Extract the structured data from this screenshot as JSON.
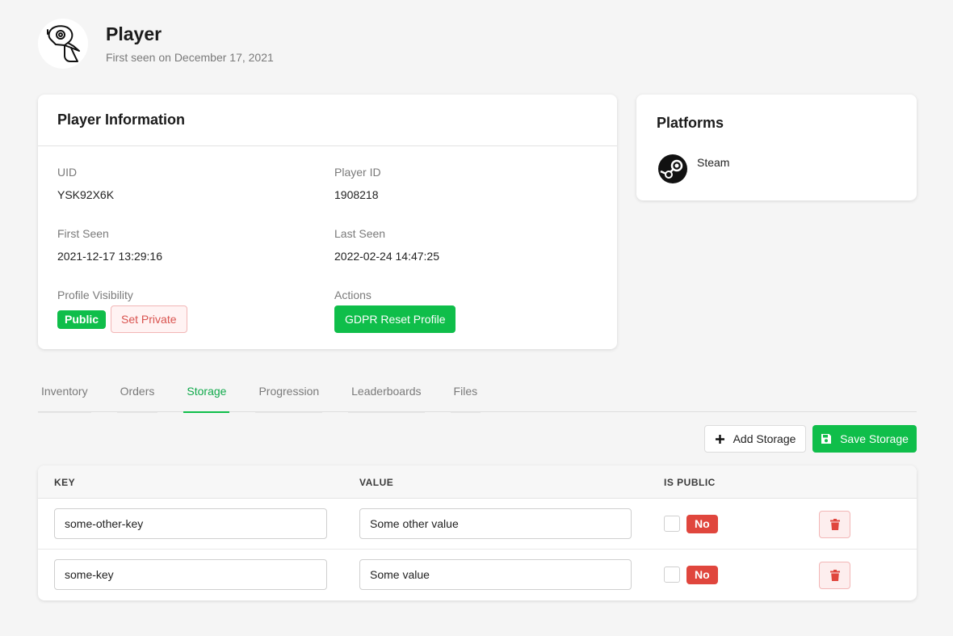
{
  "header": {
    "title": "Player",
    "subtitle": "First seen on December 17, 2021",
    "avatar_icon": "parrot-icon"
  },
  "info": {
    "title": "Player Information",
    "uid_label": "UID",
    "uid": "YSK92X6K",
    "player_id_label": "Player ID",
    "player_id": "1908218",
    "first_seen_label": "First Seen",
    "first_seen": "2021-12-17 13:29:16",
    "last_seen_label": "Last Seen",
    "last_seen": "2022-02-24 14:47:25",
    "visibility_label": "Profile Visibility",
    "visibility_value": "Public",
    "set_private_label": "Set Private",
    "actions_label": "Actions",
    "gdpr_label": "GDPR Reset Profile"
  },
  "platforms": {
    "title": "Platforms",
    "items": [
      {
        "name": "Steam",
        "icon": "steam-icon"
      }
    ]
  },
  "tabs": [
    {
      "label": "Inventory",
      "active": false
    },
    {
      "label": "Orders",
      "active": false
    },
    {
      "label": "Storage",
      "active": true
    },
    {
      "label": "Progression",
      "active": false
    },
    {
      "label": "Leaderboards",
      "active": false
    },
    {
      "label": "Files",
      "active": false
    }
  ],
  "toolbar": {
    "add_label": "Add Storage",
    "save_label": "Save Storage"
  },
  "storage": {
    "columns": [
      "KEY",
      "VALUE",
      "IS PUBLIC"
    ],
    "rows": [
      {
        "key": "some-other-key",
        "value": "Some other value",
        "public_label": "No"
      },
      {
        "key": "some-key",
        "value": "Some value",
        "public_label": "No"
      }
    ]
  },
  "colors": {
    "accent": "#0fbe4a",
    "danger": "#e0463d"
  }
}
